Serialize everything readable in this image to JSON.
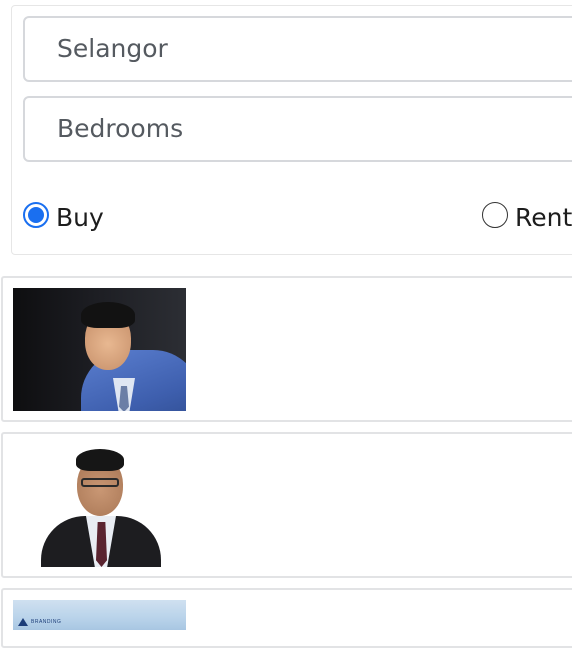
{
  "search": {
    "location_value": "Selangor",
    "bedrooms_placeholder": "Bedrooms",
    "listing_type": {
      "options": [
        {
          "label": "Buy",
          "checked": true
        },
        {
          "label": "Rent",
          "checked": false
        }
      ]
    }
  },
  "agents": [
    {
      "photo": "agent-photo-man-blue-suit-dark-background"
    },
    {
      "photo": "agent-photo-man-dark-suit-glasses-white-background"
    },
    {
      "photo": "agent-photo-building-sky"
    }
  ],
  "colors": {
    "radio_accent": "#1a6ff0",
    "field_border": "#d6d8dc",
    "card_border": "#e2e3e5",
    "text_muted": "#555a60"
  },
  "photo3": {
    "logo_text": "BRANDING"
  }
}
